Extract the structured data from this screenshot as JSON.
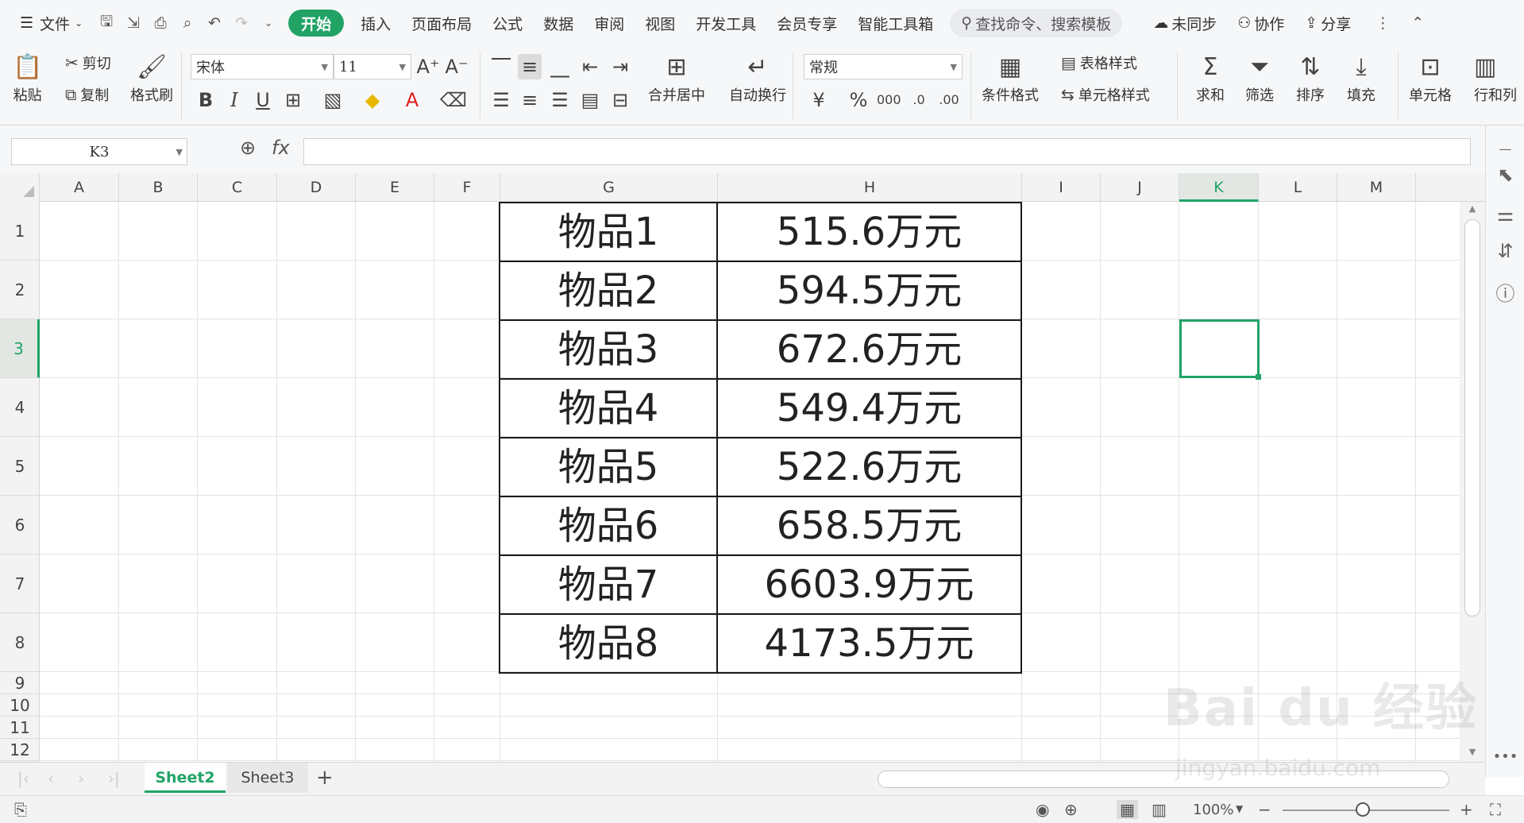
{
  "menu": {
    "file_label": "文件",
    "tabs": [
      "开始",
      "插入",
      "页面布局",
      "公式",
      "数据",
      "审阅",
      "视图",
      "开发工具",
      "会员专享",
      "智能工具箱"
    ],
    "active_tab": "开始",
    "search_placeholder": "查找命令、搜索模板",
    "sync_label": "未同步",
    "collab_label": "协作",
    "share_label": "分享"
  },
  "ribbon": {
    "paste_label": "粘贴",
    "cut_label": "剪切",
    "copy_label": "复制",
    "format_painter_label": "格式刷",
    "font_name": "宋体",
    "font_size": "11",
    "merge_center_label": "合并居中",
    "wrap_text_label": "自动换行",
    "number_format": "常规",
    "cond_format_label": "条件格式",
    "table_style_label": "表格样式",
    "cell_style_label": "单元格样式",
    "sum_label": "求和",
    "filter_label": "筛选",
    "sort_label": "排序",
    "fill_label": "填充",
    "cell_label": "单元格",
    "row_col_label": "行和列"
  },
  "formula_bar": {
    "name_box": "K3",
    "fx_label": "fx",
    "formula": ""
  },
  "sheet": {
    "columns": [
      "A",
      "B",
      "C",
      "D",
      "E",
      "F",
      "G",
      "H",
      "I",
      "J",
      "K",
      "L",
      "M"
    ],
    "rows": [
      "1",
      "2",
      "3",
      "4",
      "5",
      "6",
      "7",
      "8",
      "9",
      "10",
      "11",
      "12"
    ],
    "selected_column": "K",
    "selected_row": "3",
    "table": [
      {
        "item": "物品1",
        "value": "515.6万元"
      },
      {
        "item": "物品2",
        "value": "594.5万元"
      },
      {
        "item": "物品3",
        "value": "672.6万元"
      },
      {
        "item": "物品4",
        "value": "549.4万元"
      },
      {
        "item": "物品5",
        "value": "522.6万元"
      },
      {
        "item": "物品6",
        "value": "658.5万元"
      },
      {
        "item": "物品7",
        "value": "6603.9万元"
      },
      {
        "item": "物品8",
        "value": "4173.5万元"
      }
    ]
  },
  "tabs": {
    "sheets": [
      "Sheet2",
      "Sheet3"
    ],
    "active": "Sheet2"
  },
  "status": {
    "zoom": "100%"
  },
  "watermark": {
    "logo_text": "Bai du 经验",
    "url": "jingyan.baidu.com"
  },
  "accent_color": "#21a366"
}
